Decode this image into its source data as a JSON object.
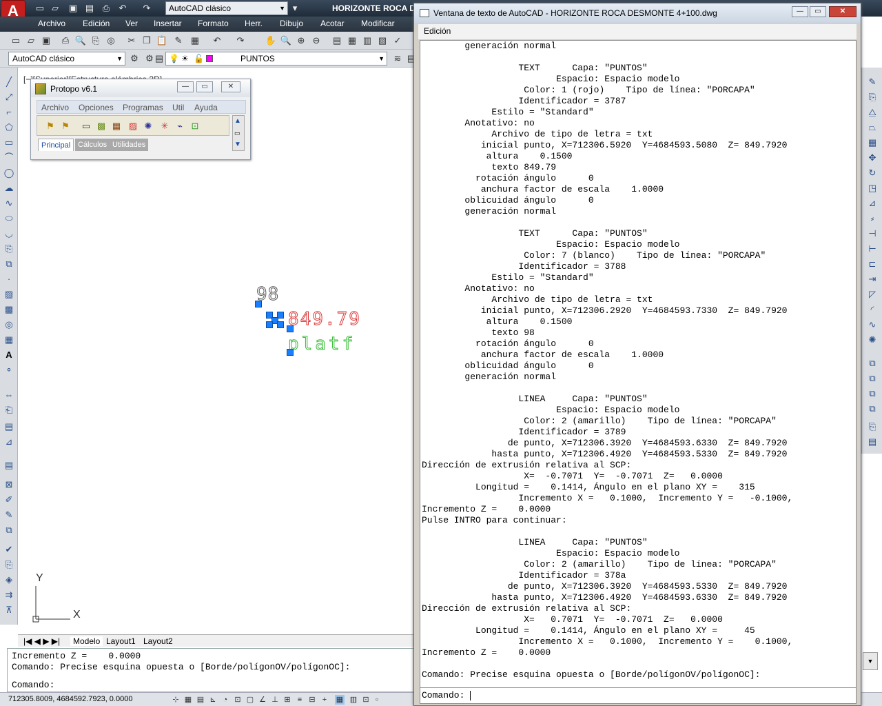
{
  "app": {
    "logo_letter": "A",
    "workspace": "AutoCAD clásico",
    "title": "HORIZONTE ROCA  D"
  },
  "menubar": [
    "Archivo",
    "Edición",
    "Ver",
    "Insertar",
    "Formato",
    "Herr.",
    "Dibujo",
    "Acotar",
    "Modificar"
  ],
  "toolbar": {
    "workspace_combo": "AutoCAD clásico",
    "layer_combo": "PUNTOS",
    "layer_color": "#ff00ff"
  },
  "viewport_label": "[−][Superior][Estructura alámbrica 2D]",
  "protopo": {
    "title": "Protopo v6.1",
    "menu": [
      "Archivo",
      "Opciones",
      "Programas",
      "Util",
      "Ayuda"
    ],
    "tabs": [
      "Principal",
      "Cálculos",
      "Utilidades"
    ]
  },
  "canvas": {
    "text_98": "98",
    "text_elev": "849.79",
    "text_platf": "platf",
    "ucs_y": "Y",
    "ucs_x": "X"
  },
  "layout_tabs": [
    "Modelo",
    "Layout1",
    "Layout2"
  ],
  "cmdline": {
    "line1": "Incremento Z =    0.0000",
    "line2": "Comando: Precise esquina opuesta o [Borde/polígonOV/polígonOC]:",
    "prompt": "Comando:"
  },
  "status": {
    "coords": "712305.8009, 4684592.7923, 0.0000"
  },
  "textwindow": {
    "title": "Ventana de texto de AutoCAD - HORIZONTE ROCA  DESMONTE 4+100.dwg",
    "menu": "Edición",
    "lines": [
      "        generación normal",
      "",
      "                  TEXT      Capa: \"PUNTOS\"",
      "                         Espacio: Espacio modelo",
      "                   Color: 1 (rojo)    Tipo de línea: \"PORCAPA\"",
      "                  Identificador = 3787",
      "             Estilo = \"Standard\"",
      "        Anotativo: no",
      "             Archivo de tipo de letra = txt",
      "           inicial punto, X=712306.5920  Y=4684593.5080  Z= 849.7920",
      "            altura    0.1500",
      "             texto 849.79",
      "          rotación ángulo      0",
      "           anchura factor de escala    1.0000",
      "        oblicuidad ángulo      0",
      "        generación normal",
      "",
      "                  TEXT      Capa: \"PUNTOS\"",
      "                         Espacio: Espacio modelo",
      "                   Color: 7 (blanco)    Tipo de línea: \"PORCAPA\"",
      "                  Identificador = 3788",
      "             Estilo = \"Standard\"",
      "        Anotativo: no",
      "             Archivo de tipo de letra = txt",
      "           inicial punto, X=712306.2920  Y=4684593.7330  Z= 849.7920",
      "            altura    0.1500",
      "             texto 98",
      "          rotación ángulo      0",
      "           anchura factor de escala    1.0000",
      "        oblicuidad ángulo      0",
      "        generación normal",
      "",
      "                  LINEA     Capa: \"PUNTOS\"",
      "                         Espacio: Espacio modelo",
      "                   Color: 2 (amarillo)    Tipo de línea: \"PORCAPA\"",
      "                  Identificador = 3789",
      "                de punto, X=712306.3920  Y=4684593.6330  Z= 849.7920",
      "             hasta punto, X=712306.4920  Y=4684593.5330  Z= 849.7920",
      "Dirección de extrusión relativa al SCP:",
      "                   X=  -0.7071  Y=  -0.7071  Z=   0.0000",
      "          Longitud =    0.1414, Ángulo en el plano XY =    315",
      "                  Incremento X =   0.1000,  Incremento Y =   -0.1000,",
      "Incremento Z =    0.0000",
      "Pulse INTRO para continuar:",
      "",
      "                  LINEA     Capa: \"PUNTOS\"",
      "                         Espacio: Espacio modelo",
      "                   Color: 2 (amarillo)    Tipo de línea: \"PORCAPA\"",
      "                  Identificador = 378a",
      "                de punto, X=712306.3920  Y=4684593.5330  Z= 849.7920",
      "             hasta punto, X=712306.4920  Y=4684593.6330  Z= 849.7920",
      "Dirección de extrusión relativa al SCP:",
      "                   X=   0.7071  Y=  -0.7071  Z=   0.0000",
      "          Longitud =    0.1414, Ángulo en el plano XY =     45",
      "                  Incremento X =   0.1000,  Incremento Y =    0.1000,",
      "Incremento Z =    0.0000",
      "",
      "Comando: Precise esquina opuesta o [Borde/polígonOV/polígonOC]:"
    ],
    "cmd_prompt": "Comando: "
  }
}
